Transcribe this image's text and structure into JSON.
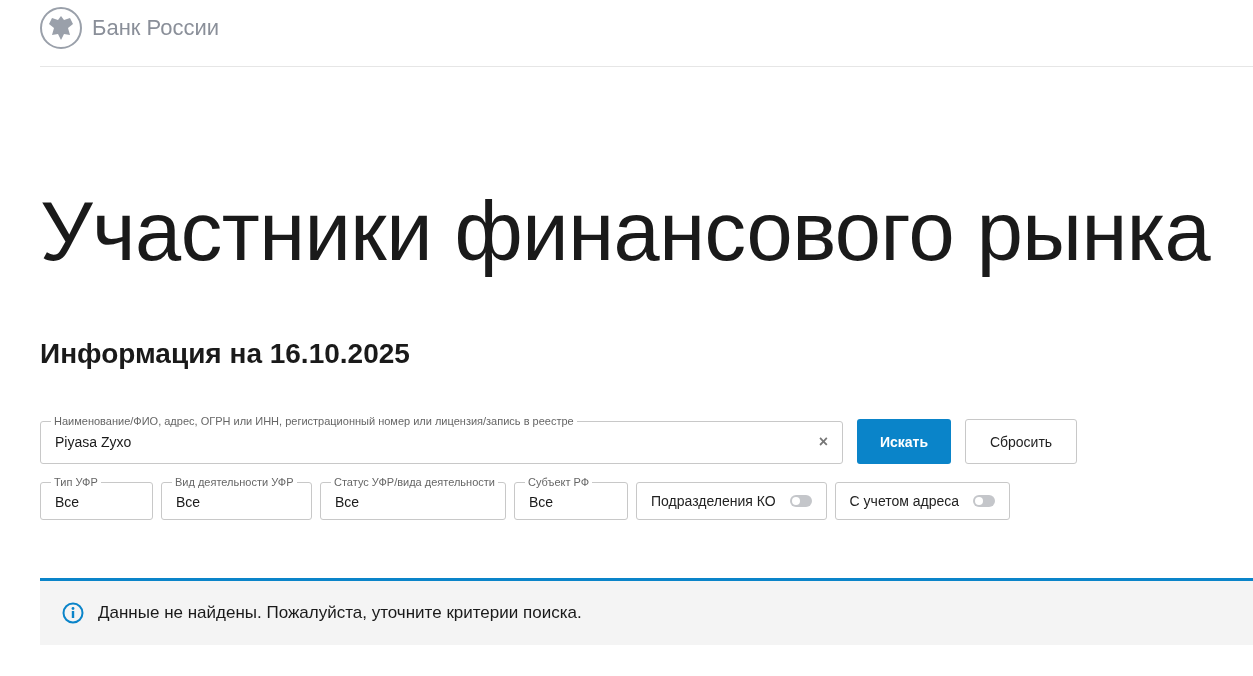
{
  "header": {
    "logo_text": "Банк России"
  },
  "title": "Участники финансового рынка",
  "subtitle": "Информация на 16.10.2025",
  "search": {
    "label": "Наименование/ФИО, адрес, ОГРН или ИНН, регистрационный номер или лицензия/запись в реестре",
    "value": "Piyasa Zyxo",
    "clear": "×"
  },
  "buttons": [
    {
      "label": "Искать",
      "kind": "primary"
    },
    {
      "label": "Сбросить",
      "kind": "secondary"
    }
  ],
  "filters": [
    {
      "kind": "select",
      "label": "Тип УФР",
      "value": "Все"
    },
    {
      "kind": "select",
      "label": "Вид деятельности УФР",
      "value": "Все"
    },
    {
      "kind": "select",
      "label": "Статус УФР/вида деятельности",
      "value": "Все"
    },
    {
      "kind": "select",
      "label": "Субъект РФ",
      "value": "Все"
    },
    {
      "kind": "toggle",
      "label": "Подразделения КО",
      "on": false
    },
    {
      "kind": "toggle",
      "label": "С учетом адреса",
      "on": false
    }
  ],
  "alert": {
    "message": "Данные не найдены. Пожалуйста, уточните критерии поиска."
  }
}
